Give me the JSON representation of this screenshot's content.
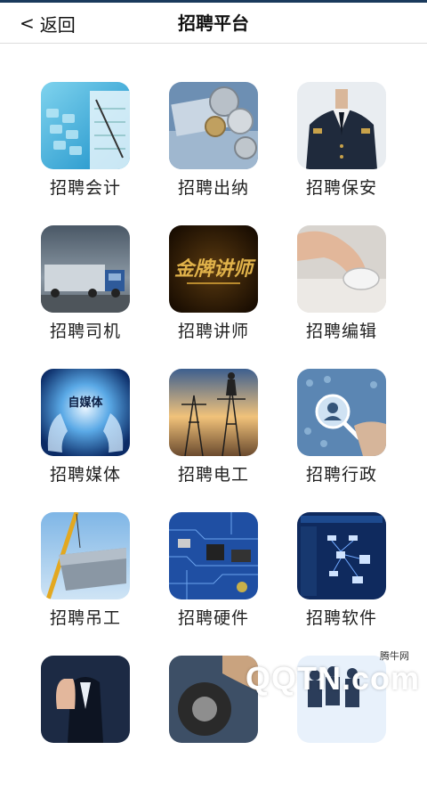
{
  "header": {
    "back_label": "返回",
    "title": "招聘平台"
  },
  "grid": {
    "items": [
      {
        "label": "招聘会计",
        "icon": "calculator-icon"
      },
      {
        "label": "招聘出纳",
        "icon": "coins-icon"
      },
      {
        "label": "招聘保安",
        "icon": "security-guard-icon"
      },
      {
        "label": "招聘司机",
        "icon": "truck-icon"
      },
      {
        "label": "招聘讲师",
        "icon": "lecturer-icon",
        "overlay_text": "金牌讲师"
      },
      {
        "label": "招聘编辑",
        "icon": "mouse-hand-icon"
      },
      {
        "label": "招聘媒体",
        "icon": "media-hands-icon",
        "overlay_text": "自媒体"
      },
      {
        "label": "招聘电工",
        "icon": "power-tower-icon"
      },
      {
        "label": "招聘行政",
        "icon": "network-people-icon"
      },
      {
        "label": "招聘吊工",
        "icon": "crane-icon"
      },
      {
        "label": "招聘硬件",
        "icon": "circuit-board-icon"
      },
      {
        "label": "招聘软件",
        "icon": "software-diagram-icon"
      }
    ]
  },
  "watermark": {
    "brand": "QQTN.com",
    "small": "腾牛网"
  },
  "colors": {
    "accent_bar": "#1a3a5c",
    "divider": "#dcdcdc"
  }
}
